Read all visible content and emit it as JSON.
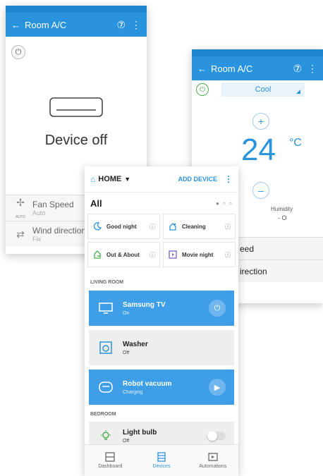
{
  "ac_off_screen": {
    "title": "Room A/C",
    "status": "Device off",
    "rows": [
      {
        "label": "Fan Speed",
        "value": "Auto",
        "icon": "fan-icon",
        "icon_caption": "AUTO"
      },
      {
        "label": "Wind direction",
        "value": "Fix",
        "icon": "wind-direction-icon"
      }
    ]
  },
  "ac_on_screen": {
    "title": "Room A/C",
    "mode": "Cool",
    "plus": "+",
    "minus": "–",
    "temperature": "24",
    "unit": "°C",
    "humidity_label": "Humidity",
    "humidity_value": "- O",
    "rows": [
      {
        "label": "eed"
      },
      {
        "label": "irection"
      }
    ]
  },
  "devices_screen": {
    "location": "HOME",
    "add_device": "ADD DEVICE",
    "filter": "All",
    "scenes": [
      {
        "label": "Good night",
        "icon": "moon-icon"
      },
      {
        "label": "Cleaning",
        "icon": "cleaning-icon"
      },
      {
        "label": "Out & About",
        "icon": "home-exit-icon"
      },
      {
        "label": "Movie night",
        "icon": "movie-icon"
      }
    ],
    "sections": {
      "living_room": "LIVING ROOM",
      "bedroom": "BEDROOM"
    },
    "devices": [
      {
        "name": "Samsung TV",
        "status": "On",
        "icon": "tv-icon",
        "action": "power"
      },
      {
        "name": "Washer",
        "status": "Off",
        "icon": "washer-icon"
      },
      {
        "name": "Robot vacuum",
        "status": "Charging",
        "icon": "robot-vacuum-icon",
        "action": "play"
      },
      {
        "name": "Light bulb",
        "status": "Off",
        "icon": "light-bulb-icon",
        "toggle_on": false
      }
    ],
    "nav": [
      {
        "label": "Dashboard",
        "icon": "dashboard-icon",
        "active": false
      },
      {
        "label": "Devices",
        "icon": "devices-icon",
        "active": true
      },
      {
        "label": "Automations",
        "icon": "automations-icon",
        "active": false
      }
    ]
  },
  "colors": {
    "primary": "#2a93dd",
    "active_card": "#3f9ee8",
    "power_on": "#4caf50"
  }
}
